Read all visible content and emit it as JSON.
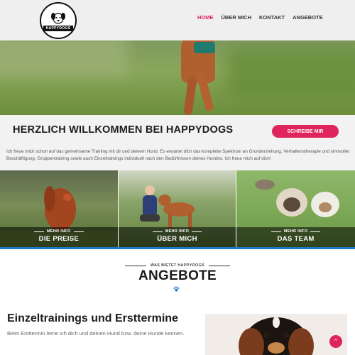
{
  "logo": {
    "text": "HAPPYDOGS"
  },
  "nav": {
    "items": [
      {
        "label": "HOME",
        "active": true
      },
      {
        "label": "ÜBER MICH",
        "active": false
      },
      {
        "label": "KONTAKT",
        "active": false
      },
      {
        "label": "ANGEBOTE",
        "active": false
      }
    ]
  },
  "welcome": {
    "title": "HERZLICH WILLKOMMEN BEI HAPPYDOGS",
    "cta_label": "SCHREIBE MIR",
    "text": "Ich freue mich schon auf das gemeinsame Training mit dir und deinem Hund. Es erwartet dich das komplette Spektrum an Grunderziehung, Verhaltenstherapie und sinnvoller Beschäftigung. Gruppentraining sowie auch Einzeltrainings individuell nach den Bedürfnissen deines Hundes. Ich freue mich auf dich!"
  },
  "tiles": [
    {
      "more": "MEHR INFO",
      "title": "DIE PREISE"
    },
    {
      "more": "MEHR INFO",
      "title": "ÜBER MICH"
    },
    {
      "more": "MEHR INFO",
      "title": "DAS TEAM"
    }
  ],
  "angebote": {
    "subtitle": "WAS BIETET HAPPYDOGS",
    "title": "ANGEBOTE",
    "offer_title": "Einzeltrainings und Ersttermine",
    "offer_text": "Beim Ersttermin lerne ich dich und deinen Hund bzw. deine Hunde kennen."
  },
  "colors": {
    "accent": "#e0255d",
    "blue": "#1e78c8"
  },
  "icons": {
    "paw": "paw-icon",
    "to_top": "chevron-up-icon"
  }
}
